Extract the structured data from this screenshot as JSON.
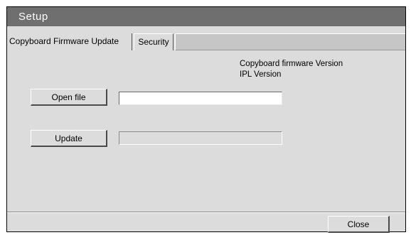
{
  "window": {
    "title": "Setup"
  },
  "tabs": [
    {
      "label": "Copyboard Firmware Update",
      "active": true
    },
    {
      "label": "Security",
      "active": false
    }
  ],
  "info": {
    "firmware_version_label": "Copyboard firmware Version",
    "ipl_version_label": "IPL Version"
  },
  "actions": {
    "open_file_label": "Open file",
    "update_label": "Update",
    "close_label": "Close"
  },
  "fields": {
    "file_path_value": "",
    "update_progress_value": ""
  },
  "colors": {
    "titlebar": "#6f6f6f",
    "panel": "#dcdcdc",
    "tab_filler": "#c6c6c6"
  }
}
